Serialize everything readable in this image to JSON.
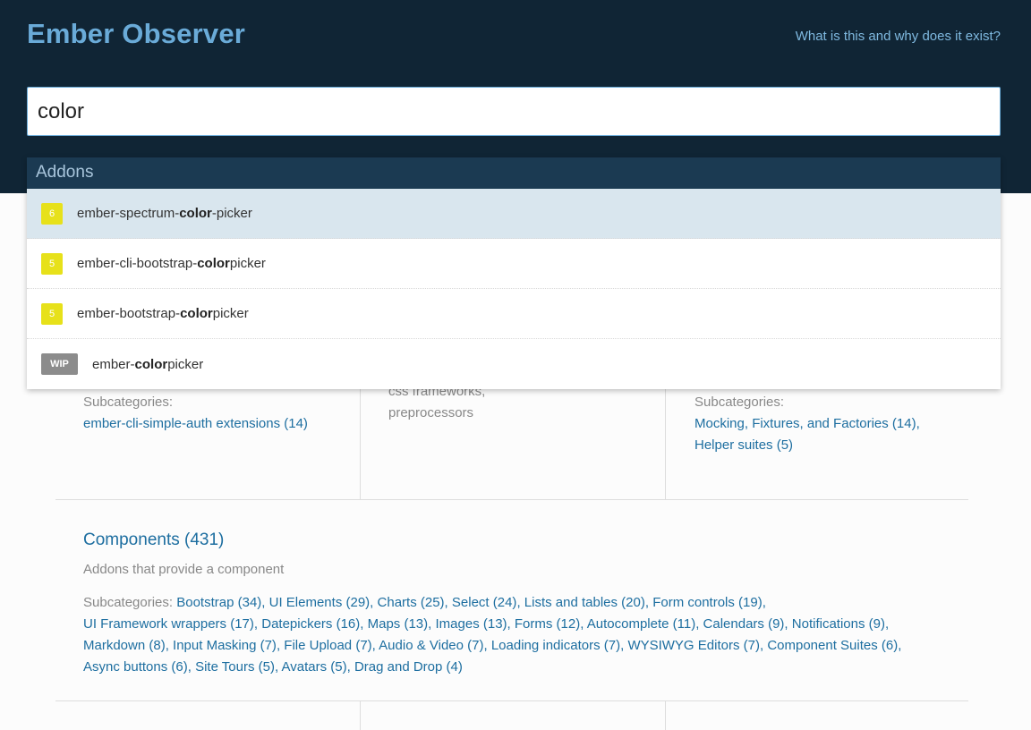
{
  "header": {
    "brand": "Ember Observer",
    "about_link": "What is this and why does it exist?"
  },
  "search": {
    "value": "color"
  },
  "dropdown": {
    "heading": "Addons",
    "results": [
      {
        "score": "6",
        "prefix": "ember-spectrum-",
        "match": "color",
        "suffix": "-picker",
        "active": true
      },
      {
        "score": "5",
        "prefix": "ember-cli-bootstrap-",
        "match": "color",
        "suffix": "picker"
      },
      {
        "score": "5",
        "prefix": "ember-bootstrap-",
        "match": "color",
        "suffix": "picker"
      },
      {
        "score": "WIP",
        "prefix": "ember-",
        "match": "color",
        "suffix": "picker"
      }
    ]
  },
  "category_row_1": {
    "col1": {
      "subcategories_label": "Subcategories:",
      "subcategories": [
        "ember-cli-simple-auth extensions (14)"
      ]
    },
    "col2": {
      "description_lines": [
        "css frameworks,",
        "preprocessors"
      ]
    },
    "col3": {
      "subcategories_label": "Subcategories:",
      "subcategories": [
        "Mocking, Fixtures, and Factories (14),",
        "Helper suites (5)"
      ]
    }
  },
  "components": {
    "title": "Components (431)",
    "description": "Addons that provide a component",
    "subcategories_label": "Subcategories:",
    "subcategories": [
      "Bootstrap (34)",
      "UI Elements (29)",
      "Charts (25)",
      "Select (24)",
      "Lists and tables (20)",
      "Form controls (19)",
      "UI Framework wrappers (17)",
      "Datepickers (16)",
      "Maps (13)",
      "Images (13)",
      "Forms (12)",
      "Autocomplete (11)",
      "Calendars (9)",
      "Notifications (9)",
      "Markdown (8)",
      "Input Masking (7)",
      "File Upload (7)",
      "Audio & Video (7)",
      "Loading indicators (7)",
      "WYSIWYG Editors (7)",
      "Component Suites (6)",
      "Async buttons (6)",
      "Site Tours (5)",
      "Avatars (5)",
      "Drag and Drop (4)"
    ]
  }
}
